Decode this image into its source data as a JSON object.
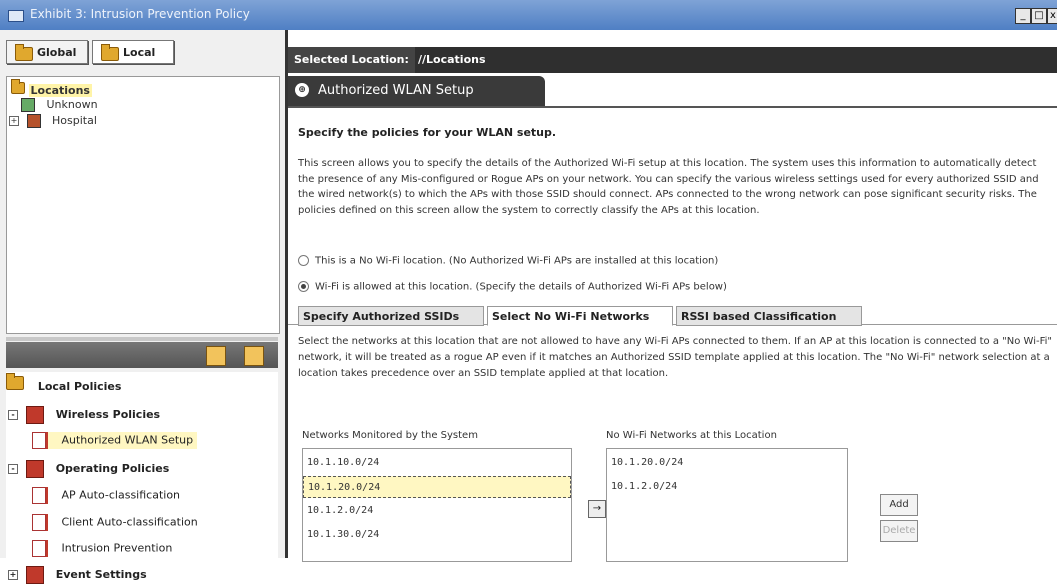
{
  "window": {
    "title": "Exhibit 3: Intrusion Prevention Policy",
    "controls": [
      "_",
      "□",
      "x"
    ]
  },
  "left": {
    "tabs": [
      {
        "label": "Global"
      },
      {
        "label": "Local"
      }
    ],
    "tree": {
      "root": "Locations",
      "children": [
        "Unknown",
        "Hospital"
      ]
    },
    "policies": {
      "root": "Local Policies",
      "groups": [
        {
          "label": "Wireless Policies",
          "items": [
            "Authorized WLAN Setup"
          ]
        },
        {
          "label": "Operating Policies",
          "items": [
            "AP Auto-classification",
            "Client Auto-classification",
            "Intrusion Prevention"
          ]
        },
        {
          "label": "Event Settings",
          "items": []
        }
      ]
    }
  },
  "right": {
    "location_label": "Selected Location:",
    "location_value": "//Locations",
    "section_title": "Authorized WLAN Setup",
    "heading": "Specify the policies for your WLAN setup.",
    "info_icon": "i",
    "description": "This screen allows you to specify the details of the Authorized Wi-Fi setup at this location. The system uses this information to automatically detect the presence of any Mis-configured or Rogue APs on your network. You can specify the various wireless settings used for every authorized SSID and the wired network(s) to which the APs with those SSID should connect. APs connected to the wrong network can pose significant security risks. The policies defined on this screen allow the system to correctly classify the APs at this location.",
    "radio_no_wifi": "This is a No Wi-Fi location. (No Authorized Wi-Fi APs are installed at this location)",
    "radio_wifi": "Wi-Fi is allowed at this location. (Specify the details of Authorized Wi-Fi APs below)",
    "subtabs": [
      "Specify Authorized SSIDs",
      "Select No Wi-Fi Networks",
      "RSSI based Classification"
    ],
    "subtab_description": "Select the networks at this location that are not allowed to have any Wi-Fi APs connected to them. If an AP at this location is connected to a \"No Wi-Fi\" network, it will be treated as a rogue AP even if it matches an Authorized SSID template applied at this location. The \"No Wi-Fi\" network selection at a location takes precedence over an SSID template applied at that location.",
    "monitored_label": "Networks Monitored by the System",
    "monitored": [
      "10.1.10.0/24",
      "10.1.20.0/24",
      "10.1.2.0/24",
      "10.1.30.0/24"
    ],
    "nowifi_label": "No Wi-Fi Networks at this Location",
    "nowifi": [
      "10.1.20.0/24",
      "10.1.2.0/24"
    ],
    "move_button": "→",
    "add_button": "Add",
    "delete_button": "Delete"
  }
}
